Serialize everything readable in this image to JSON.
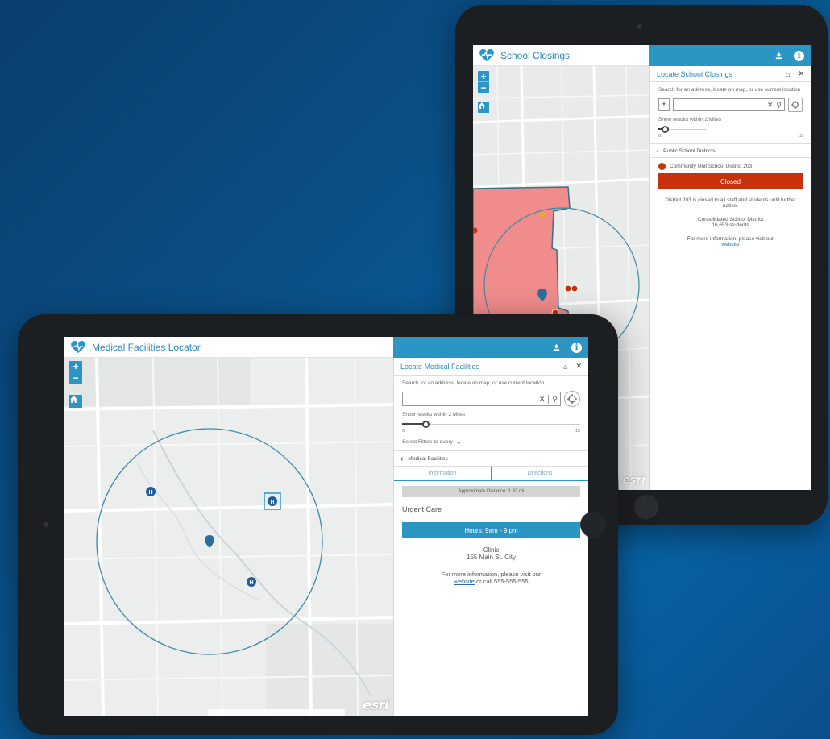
{
  "school_app": {
    "title": "School Closings",
    "panel_title": "Locate School Closings",
    "search_hint": "Search for an address, locate on map, or use current location",
    "radius_label": "Show results within 2 Miles",
    "slider_min": "0",
    "slider_max": "15",
    "slider_level": 0.13,
    "back_label": "Public School Districts",
    "district_name": "Community Unit School District 203",
    "status": "Closed",
    "desc": "District 203 is closed to all staff and students until further notice.",
    "detail_line1": "Consolidated School District",
    "detail_line2": "16,653 students",
    "more_info": "For more information, please visit our",
    "link_text": "website",
    "esri": "esri"
  },
  "medical_app": {
    "title": "Medical Facilities Locator",
    "panel_title": "Locate Medical Facilities",
    "search_hint": "Search for an address, locate on map, or use current location",
    "radius_label": "Show results within 2 Miles",
    "slider_min": "0",
    "slider_max": "15",
    "slider_level": 0.13,
    "filter_label": "Select Filters to query",
    "back_label": "Medical Facilities",
    "tabs": [
      "Information",
      "Directions"
    ],
    "distance": "Approximate Distance: 1.32 mi",
    "facility_name": "Urgent Care",
    "hours": "Hours: 9am - 9 pm",
    "type": "Clinic",
    "address": "155 Main St. City",
    "more_info_1": "For more information, please visit our",
    "link_text": "website",
    "more_info_2": "or call 555-555-555",
    "esri": "esri"
  },
  "colors": {
    "accent": "#2b96c4",
    "closed": "#c6320c",
    "district_fill": "#f08c8c"
  }
}
